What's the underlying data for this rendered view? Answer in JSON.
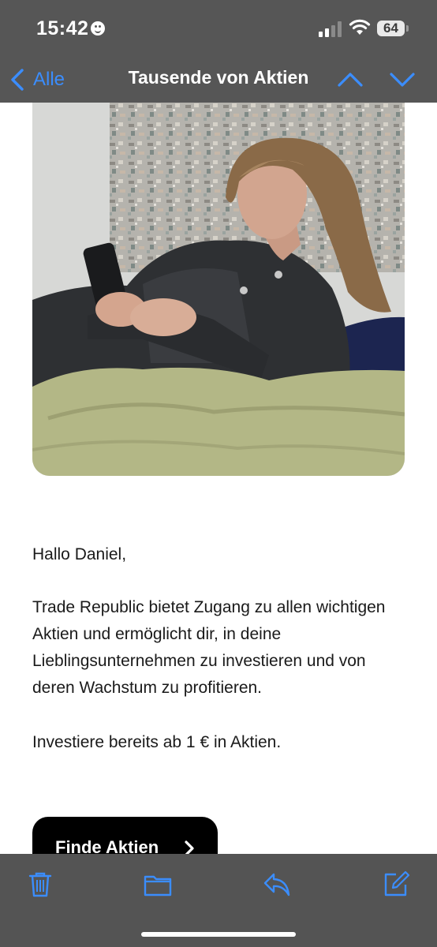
{
  "status_bar": {
    "time": "15:42",
    "battery": "64"
  },
  "nav": {
    "back_label": "Alle",
    "title": "Tausende von Aktien"
  },
  "email": {
    "greeting": "Hallo Daniel,",
    "paragraph": "Trade Republic bietet Zugang zu allen wichtigen Aktien und ermöglicht dir, in deine Lieblingsunternehmen zu investieren und von deren Wachstum zu profitieren.",
    "offer": "Investiere bereits ab 1 € in Aktien.",
    "cta_label": "Finde Aktien"
  },
  "toolbar": {
    "icons": [
      "trash-icon",
      "folder-icon",
      "reply-icon",
      "compose-icon"
    ]
  },
  "colors": {
    "accent": "#3b8dfd",
    "bar_bg": "#565656",
    "cta_bg": "#000000"
  }
}
